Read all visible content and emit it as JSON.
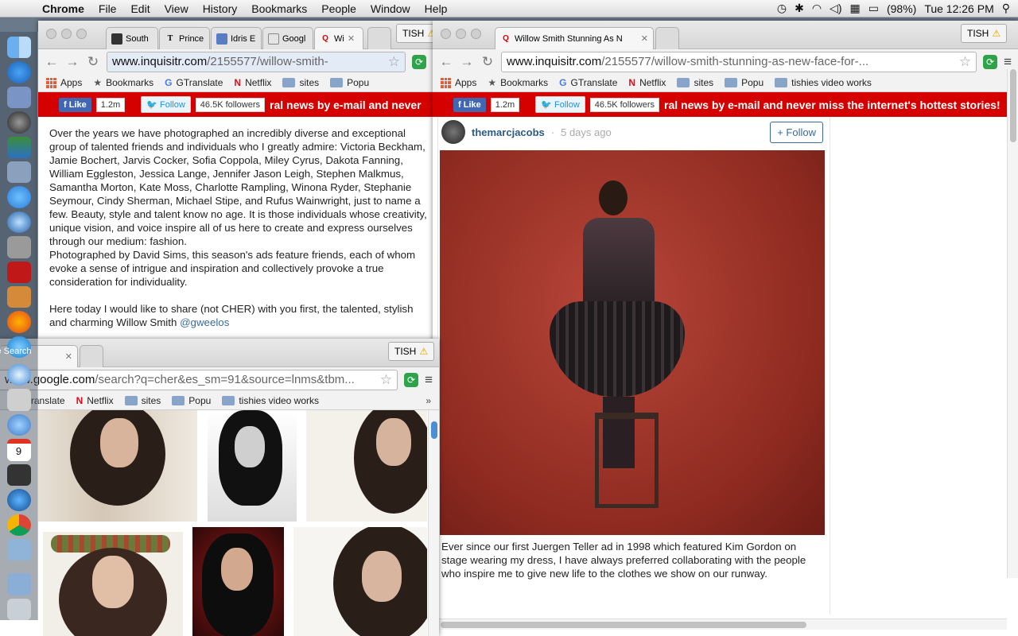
{
  "menubar": {
    "app": "Chrome",
    "items": [
      "File",
      "Edit",
      "View",
      "History",
      "Bookmarks",
      "People",
      "Window",
      "Help"
    ],
    "battery": "(98%)",
    "clock": "Tue 12:26 PM"
  },
  "dock": {
    "icons": [
      "finder-icon",
      "app-store-icon",
      "preview-icon",
      "dashboard-icon",
      "numbers-icon",
      "xcode-icon",
      "facetime-icon",
      "safari-blue-icon",
      "system-preferences-icon",
      "photo-booth-icon",
      "image-capture-icon",
      "firefox-icon",
      "itunes-icon",
      "safari-icon",
      "alfred-icon",
      "cloud-icon",
      "calendar-icon",
      "dvd-player-icon",
      "quicktime-icon",
      "chrome-icon",
      "preview-photos-icon",
      "documents-folder-icon",
      "trash-icon"
    ],
    "calendar_day": "9",
    "search_label": "e Search"
  },
  "window_left": {
    "tabs": [
      "South",
      "Prince",
      "Idris E",
      "Googl",
      "Wi"
    ],
    "profile": "TISH",
    "url_host": "www.inquisitr.com",
    "url_path": "/2155577/willow-smith-",
    "bookmarks": [
      "Apps",
      "Bookmarks",
      "GTranslate",
      "Netflix",
      "sites",
      "Popu"
    ],
    "promo": {
      "like": "Like",
      "like_count": "1.2m",
      "twitter_follow": "Follow",
      "twitter_count": "46.5K followers",
      "text": "ral news by e-mail and never"
    },
    "article": {
      "p1": "Over the years we have photographed an incredibly diverse and exceptional group of talented friends and individuals who I greatly admire: Victoria Beckham, Jamie Bochert, Jarvis Cocker, Sofia Coppola, Miley Cyrus, Dakota Fanning, William Eggleston, Jessica Lange, Jennifer Jason Leigh, Stephen Malkmus, Samantha Morton, Kate Moss, Charlotte Rampling, Winona Ryder, Stephanie Seymour, Cindy Sherman, Michael Stipe, and Rufus Wainwright, just to name a few. Beauty, style and talent know no age. It is those individuals whose creativity, unique vision, and voice inspire all of us here to create and express ourselves through our medium: fashion.",
      "p1b": "Photographed by David Sims, this season's ads feature friends, each of whom evoke a sense of intrigue and inspiration and collectively provoke a true consideration for individuality.",
      "p2": "Here today I would like to share (not CHER) with you first, the talented, stylish and charming Willow Smith ",
      "mention": "@gweelos"
    }
  },
  "window_google": {
    "profile": "TISH",
    "url_host": "www.google.com",
    "url_path": "/search?q=cher&es_sm=91&source=lnms&tbm...",
    "bookmarks": [
      "Translate",
      "Netflix",
      "sites",
      "Popu",
      "tishies video works"
    ],
    "more": "»"
  },
  "window_right": {
    "tab": "Willow Smith Stunning As N",
    "profile": "TISH",
    "url_host": "www.inquisitr.com",
    "url_path": "/2155577/willow-smith-stunning-as-new-face-for-...",
    "bookmarks": [
      "Apps",
      "Bookmarks",
      "GTranslate",
      "Netflix",
      "sites",
      "Popu",
      "tishies video works"
    ],
    "promo": {
      "like": "Like",
      "like_count": "1.2m",
      "twitter_follow": "Follow",
      "twitter_count": "46.5K followers",
      "text": "ral news by e-mail and never miss the internet's hottest stories!"
    },
    "instagram": {
      "user": "themarcjacobs",
      "time": "5 days ago",
      "follow": "+ Follow",
      "caption": "Ever since our first Juergen Teller ad in 1998 which featured Kim Gordon on stage wearing my dress, I have always preferred collaborating with the people who inspire me to give new life to the clothes we show on our runway."
    }
  }
}
